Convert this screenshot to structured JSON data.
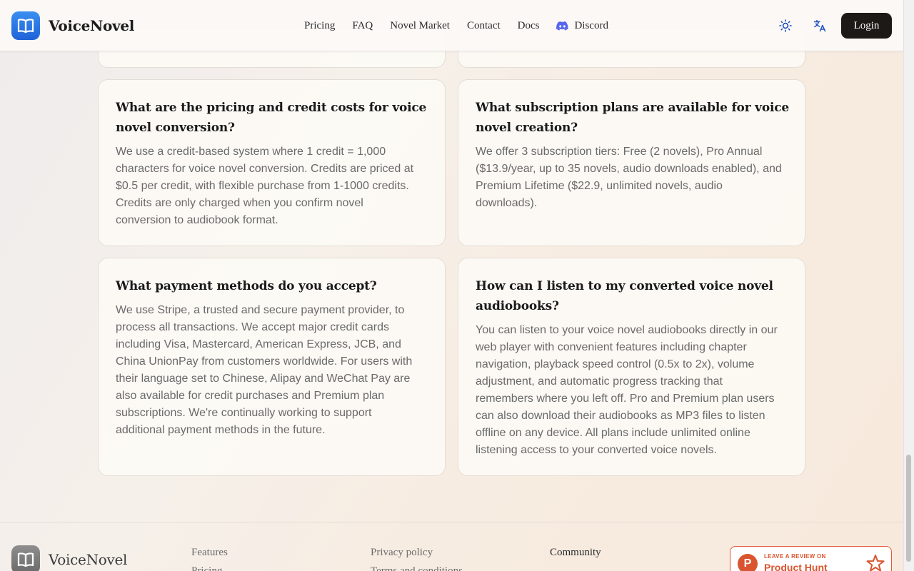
{
  "brand": {
    "name": "VoiceNovel",
    "logo_icon": "book-open-icon"
  },
  "nav": {
    "items": [
      "Pricing",
      "FAQ",
      "Novel Market",
      "Contact",
      "Docs",
      "Discord"
    ],
    "theme_icon": "sun-icon",
    "language_icon": "translate-icon",
    "login_label": "Login"
  },
  "faq": [
    {
      "question": "What are the pricing and credit costs for voice novel conversion?",
      "answer_lines": [
        "We use a credit-based system where 1 credit = 1,000",
        "characters for voice novel conversion. Credits are priced at",
        "$0.5 per credit, with flexible purchase from 1-1000 credits.",
        "Credits are only charged when you confirm novel",
        "conversion to audiobook format."
      ]
    },
    {
      "question": "What subscription plans are available for voice novel creation?",
      "answer_lines": [
        "We offer 3 subscription tiers: Free (2 novels), Pro Annual",
        "($13.9/year, up to 35 novels, audio downloads enabled), and",
        "Premium Lifetime ($22.9, unlimited novels, audio",
        "downloads)."
      ]
    },
    {
      "question": "What payment methods do you accept?",
      "answer_lines": [
        "We use Stripe, a trusted and secure payment provider, to",
        "process all transactions. We accept major credit cards",
        "including Visa, Mastercard, American Express, JCB, and",
        "China UnionPay from customers worldwide. For users with",
        "their language set to Chinese, Alipay and WeChat Pay are",
        "also available for credit purchases and Premium plan",
        "subscriptions. We're continually working to support",
        "additional payment methods in the future."
      ]
    },
    {
      "question": "How can I listen to my converted voice novel audiobooks?",
      "answer_lines": [
        "You can listen to your voice novel audiobooks directly in our",
        "web player with convenient features including chapter",
        "navigation, playback speed control (0.5x to 2x), volume",
        "adjustment, and automatic progress tracking that",
        "remembers where you left off. Pro and Premium plan users",
        "can also download their audiobooks as MP3 files to listen",
        "offline on any device. All plans include unlimited online",
        "listening access to your converted voice novels."
      ]
    }
  ],
  "footer": {
    "brand": "VoiceNovel",
    "col1": [
      "Features",
      "Pricing"
    ],
    "col2": [
      "Privacy policy",
      "Terms and conditions"
    ],
    "col3_title": "Community",
    "product_hunt": {
      "small": "LEAVE A REVIEW ON",
      "big": "Product Hunt",
      "letter": "P"
    }
  },
  "colors": {
    "accent": "#1f63d8",
    "login_bg": "#1c1916",
    "product_hunt": "#da552f"
  }
}
